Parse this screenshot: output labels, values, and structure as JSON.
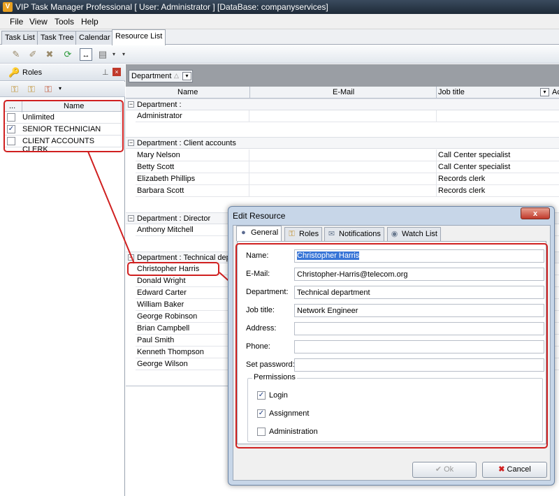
{
  "window": {
    "title": "VIP Task Manager Professional [ User: Administrator ] [DataBase: companyservices]"
  },
  "menu": [
    "File",
    "View",
    "Tools",
    "Help"
  ],
  "tabs": [
    "Task List",
    "Task Tree",
    "Calendar",
    "Resource List"
  ],
  "roles_panel": {
    "title": "Roles",
    "col_header_dots": "...",
    "col_header_name": "Name",
    "roles": [
      {
        "name": "Unlimited",
        "checked": false
      },
      {
        "name": "SENIOR TECHNICIAN",
        "checked": true
      },
      {
        "name": "CLIENT ACCOUNTS CLERK",
        "checked": false
      }
    ]
  },
  "grid": {
    "group_by_label": "Department",
    "columns": [
      "Name",
      "E-Mail",
      "Job title",
      "Ac"
    ],
    "groups": [
      {
        "label": "Department :",
        "rows": [
          {
            "name": "Administrator",
            "job": ""
          }
        ]
      },
      {
        "label": "Department : Client accounts",
        "rows": [
          {
            "name": "Mary Nelson",
            "job": "Call Center specialist"
          },
          {
            "name": "Betty Scott",
            "job": "Call Center specialist"
          },
          {
            "name": "Elizabeth Phillips",
            "job": "Records clerk"
          },
          {
            "name": "Barbara Scott",
            "job": "Records clerk"
          }
        ]
      },
      {
        "label": "Department : Director",
        "rows": [
          {
            "name": "Anthony Mitchell",
            "job": ""
          }
        ]
      },
      {
        "label": "Department : Technical depa",
        "rows": [
          {
            "name": "Christopher Harris"
          },
          {
            "name": "Donald Wright"
          },
          {
            "name": "Edward Carter"
          },
          {
            "name": "William Baker"
          },
          {
            "name": "George Robinson"
          },
          {
            "name": "Brian Campbell"
          },
          {
            "name": "Paul Smith"
          },
          {
            "name": "Kenneth Thompson"
          },
          {
            "name": "George Wilson"
          }
        ]
      }
    ]
  },
  "dialog": {
    "title": "Edit Resource",
    "close": "x",
    "tabs": [
      "General",
      "Roles",
      "Notifications",
      "Watch List"
    ],
    "fields": {
      "name_label": "Name:",
      "name": "Christopher Harris",
      "email_label": "E-Mail:",
      "email": "Christopher-Harris@telecom.org",
      "department_label": "Department:",
      "department": "Technical department",
      "job_label": "Job title:",
      "job": "Network Engineer",
      "address_label": "Address:",
      "address": "",
      "phone_label": "Phone:",
      "phone": "",
      "password_label": "Set password:",
      "password": ""
    },
    "permissions": {
      "legend": "Permissions",
      "items": [
        {
          "label": "Login",
          "checked": true
        },
        {
          "label": "Assignment",
          "checked": true
        },
        {
          "label": "Administration",
          "checked": false
        }
      ]
    },
    "ok_label": "Ok",
    "cancel_label": "Cancel"
  },
  "colors": {
    "highlight": "#d02020",
    "selection": "#3875d7"
  }
}
